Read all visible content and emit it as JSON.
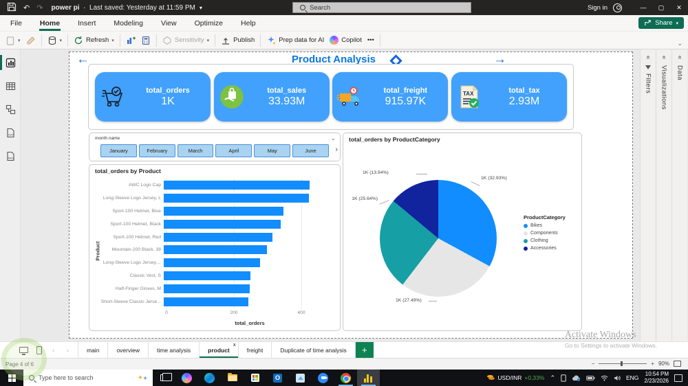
{
  "titlebar": {
    "title": "power pi",
    "saved": "Last saved: Yesterday at 11:59 PM",
    "search_placeholder": "Search",
    "sign_in": "Sign in",
    "minimize": "—",
    "maximize": "▢",
    "close": "✕"
  },
  "menubar": {
    "items": [
      "File",
      "Home",
      "Insert",
      "Modeling",
      "View",
      "Optimize",
      "Help"
    ],
    "active": "Home",
    "share_label": "Share"
  },
  "ribbon": {
    "refresh_label": "Refresh",
    "sensitivity_label": "Sensitivity",
    "publish_label": "Publish",
    "prep_ai_label": "Prep data for AI",
    "copilot_label": "Copilot",
    "more_label": "•••"
  },
  "side_panels": {
    "filters": "Filters",
    "visualizations": "Visualizations",
    "data": "Data"
  },
  "canvas": {
    "title": "Product Analysis"
  },
  "kpis": [
    {
      "label": "total_orders",
      "value": "1K",
      "icon": "cart-check-icon"
    },
    {
      "label": "total_sales",
      "value": "33.93M",
      "icon": "hand-bag-icon"
    },
    {
      "label": "total_freight",
      "value": "915.97K",
      "icon": "truck-icon"
    },
    {
      "label": "total_tax",
      "value": "2.93M",
      "icon": "tax-doc-icon"
    }
  ],
  "slicer": {
    "label": "month name",
    "months": [
      "January",
      "February",
      "March",
      "April",
      "May",
      "June"
    ]
  },
  "chart_data": [
    {
      "type": "bar",
      "orientation": "horizontal",
      "title": "total_orders by Product",
      "categories": [
        "AWC Logo Cap",
        "Long-Sleeve Logo Jersey, L",
        "Sport-100 Helmet, Blue",
        "Sport-100 Helmet, Black",
        "Sport-100 Helmet, Red",
        "Mountain-200 Black, 38",
        "Long-Sleeve Logo Jersey,...",
        "Classic Vest, S",
        "Half-Finger Gloves, M",
        "Short-Sleeve Classic Jerse..."
      ],
      "values": [
        433,
        430,
        355,
        347,
        322,
        306,
        286,
        257,
        255,
        251
      ],
      "xlabel": "total_orders",
      "ylabel": "Product",
      "x_ticks": [
        0,
        200,
        400
      ],
      "xlim": [
        0,
        450
      ],
      "bar_color": "#118DFF",
      "grid": true
    },
    {
      "type": "pie",
      "title": "total_orders by ProductCategory",
      "legend_title": "ProductCategory",
      "legend_position": "right",
      "categories": [
        "Bikes",
        "Components",
        "Clothing",
        "Accessories"
      ],
      "values_pct": [
        32.93,
        27.49,
        25.64,
        13.94
      ],
      "labels": [
        "1K (32.93%)",
        "1K (27.49%)",
        "1K (25.64%)",
        "1K (13.94%)"
      ],
      "colors": [
        "#118DFF",
        "#E6E6E6",
        "#16A0A6",
        "#12239E"
      ]
    }
  ],
  "page_tabs": {
    "tabs": [
      "main",
      "overview",
      "time analysis",
      "product",
      "freight",
      "Duplicate of time analysis"
    ],
    "active": "product"
  },
  "statusbar": {
    "page": "Page 4 of 6",
    "zoom": "90%"
  },
  "watermark": {
    "line1": "Activate Windows",
    "line2": "Go to Settings to activate Windows."
  },
  "taskbar": {
    "search_placeholder": "Type here to search",
    "tray": {
      "ticker": "USD/INR",
      "change": "+0,33%",
      "lang": "ENG",
      "time": "10:54 PM",
      "date": "2/23/2026"
    }
  }
}
